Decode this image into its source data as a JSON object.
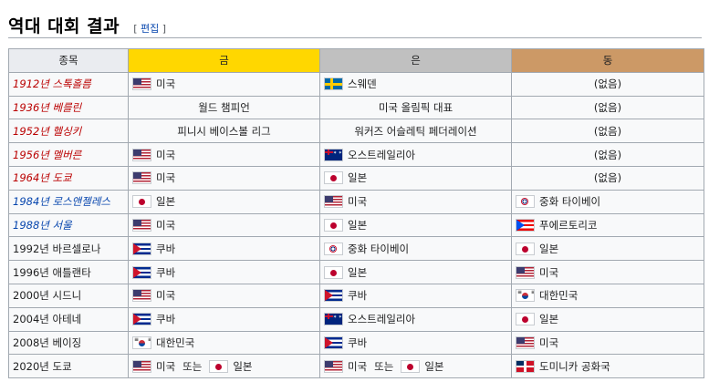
{
  "heading": {
    "title": "역대 대회 결과",
    "edit_open": "[",
    "edit_label": "편집",
    "edit_close": "]"
  },
  "columns": {
    "event": "종목",
    "gold": "금",
    "silver": "은",
    "bronze": "동"
  },
  "rows": [
    {
      "event": "1912년 스톡홀름",
      "event_style": "red-italic",
      "gold": [
        {
          "flag": "usa",
          "text": "미국"
        }
      ],
      "silver": [
        {
          "flag": "swe",
          "text": "스웨덴"
        }
      ],
      "bronze": [
        {
          "text": "(없음)"
        }
      ]
    },
    {
      "event": "1936년 베를린",
      "event_style": "red-italic",
      "gold": [
        {
          "text": "월드 챔피언"
        }
      ],
      "silver": [
        {
          "text": "미국 올림픽 대표"
        }
      ],
      "bronze": [
        {
          "text": "(없음)"
        }
      ]
    },
    {
      "event": "1952년 헬싱키",
      "event_style": "red-italic",
      "gold": [
        {
          "text": "피니시 베이스볼 리그"
        }
      ],
      "silver": [
        {
          "text": "워커즈 어슬레틱 페더레이션"
        }
      ],
      "bronze": [
        {
          "text": "(없음)"
        }
      ]
    },
    {
      "event": "1956년 멜버른",
      "event_style": "red-italic",
      "gold": [
        {
          "flag": "usa",
          "text": "미국"
        }
      ],
      "silver": [
        {
          "flag": "aus",
          "text": "오스트레일리아"
        }
      ],
      "bronze": [
        {
          "text": "(없음)"
        }
      ]
    },
    {
      "event": "1964년 도쿄",
      "event_style": "red-italic",
      "gold": [
        {
          "flag": "usa",
          "text": "미국"
        }
      ],
      "silver": [
        {
          "flag": "jpn",
          "text": "일본"
        }
      ],
      "bronze": [
        {
          "text": "(없음)"
        }
      ]
    },
    {
      "event": "1984년 로스앤젤레스",
      "event_style": "blue-italic",
      "gold": [
        {
          "flag": "jpn",
          "text": "일본"
        }
      ],
      "silver": [
        {
          "flag": "usa",
          "text": "미국"
        }
      ],
      "bronze": [
        {
          "flag": "tpe",
          "text": "중화 타이베이"
        }
      ]
    },
    {
      "event": "1988년 서울",
      "event_style": "blue-italic",
      "gold": [
        {
          "flag": "usa",
          "text": "미국"
        }
      ],
      "silver": [
        {
          "flag": "jpn",
          "text": "일본"
        }
      ],
      "bronze": [
        {
          "flag": "pur",
          "text": "푸에르토리코"
        }
      ]
    },
    {
      "event": "1992년 바르셀로나",
      "event_style": "plain",
      "gold": [
        {
          "flag": "cub",
          "text": "쿠바"
        }
      ],
      "silver": [
        {
          "flag": "tpe",
          "text": "중화 타이베이"
        }
      ],
      "bronze": [
        {
          "flag": "jpn",
          "text": "일본"
        }
      ]
    },
    {
      "event": "1996년 애틀랜타",
      "event_style": "plain",
      "gold": [
        {
          "flag": "cub",
          "text": "쿠바"
        }
      ],
      "silver": [
        {
          "flag": "jpn",
          "text": "일본"
        }
      ],
      "bronze": [
        {
          "flag": "usa",
          "text": "미국"
        }
      ]
    },
    {
      "event": "2000년 시드니",
      "event_style": "plain",
      "gold": [
        {
          "flag": "usa",
          "text": "미국"
        }
      ],
      "silver": [
        {
          "flag": "cub",
          "text": "쿠바"
        }
      ],
      "bronze": [
        {
          "flag": "kor",
          "text": "대한민국"
        }
      ]
    },
    {
      "event": "2004년 아테네",
      "event_style": "plain",
      "gold": [
        {
          "flag": "cub",
          "text": "쿠바"
        }
      ],
      "silver": [
        {
          "flag": "aus",
          "text": "오스트레일리아"
        }
      ],
      "bronze": [
        {
          "flag": "jpn",
          "text": "일본"
        }
      ]
    },
    {
      "event": "2008년 베이징",
      "event_style": "plain",
      "gold": [
        {
          "flag": "kor",
          "text": "대한민국"
        }
      ],
      "silver": [
        {
          "flag": "cub",
          "text": "쿠바"
        }
      ],
      "bronze": [
        {
          "flag": "usa",
          "text": "미국"
        }
      ]
    },
    {
      "event": "2020년 도쿄",
      "event_style": "plain",
      "gold": [
        {
          "flag": "usa",
          "text": "미국"
        },
        {
          "text": "또는"
        },
        {
          "flag": "jpn",
          "text": "일본"
        }
      ],
      "silver": [
        {
          "flag": "usa",
          "text": "미국"
        },
        {
          "text": "또는"
        },
        {
          "flag": "jpn",
          "text": "일본"
        }
      ],
      "bronze": [
        {
          "flag": "dom",
          "text": "도미니카 공화국"
        }
      ]
    }
  ],
  "colors": {
    "gold": "#ffd700",
    "silver": "#c0c0c0",
    "bronze": "#cc9966",
    "header": "#eaecf0",
    "cell": "#f8f9fa",
    "red_link": "#ba0000",
    "blue_link": "#0645ad"
  }
}
